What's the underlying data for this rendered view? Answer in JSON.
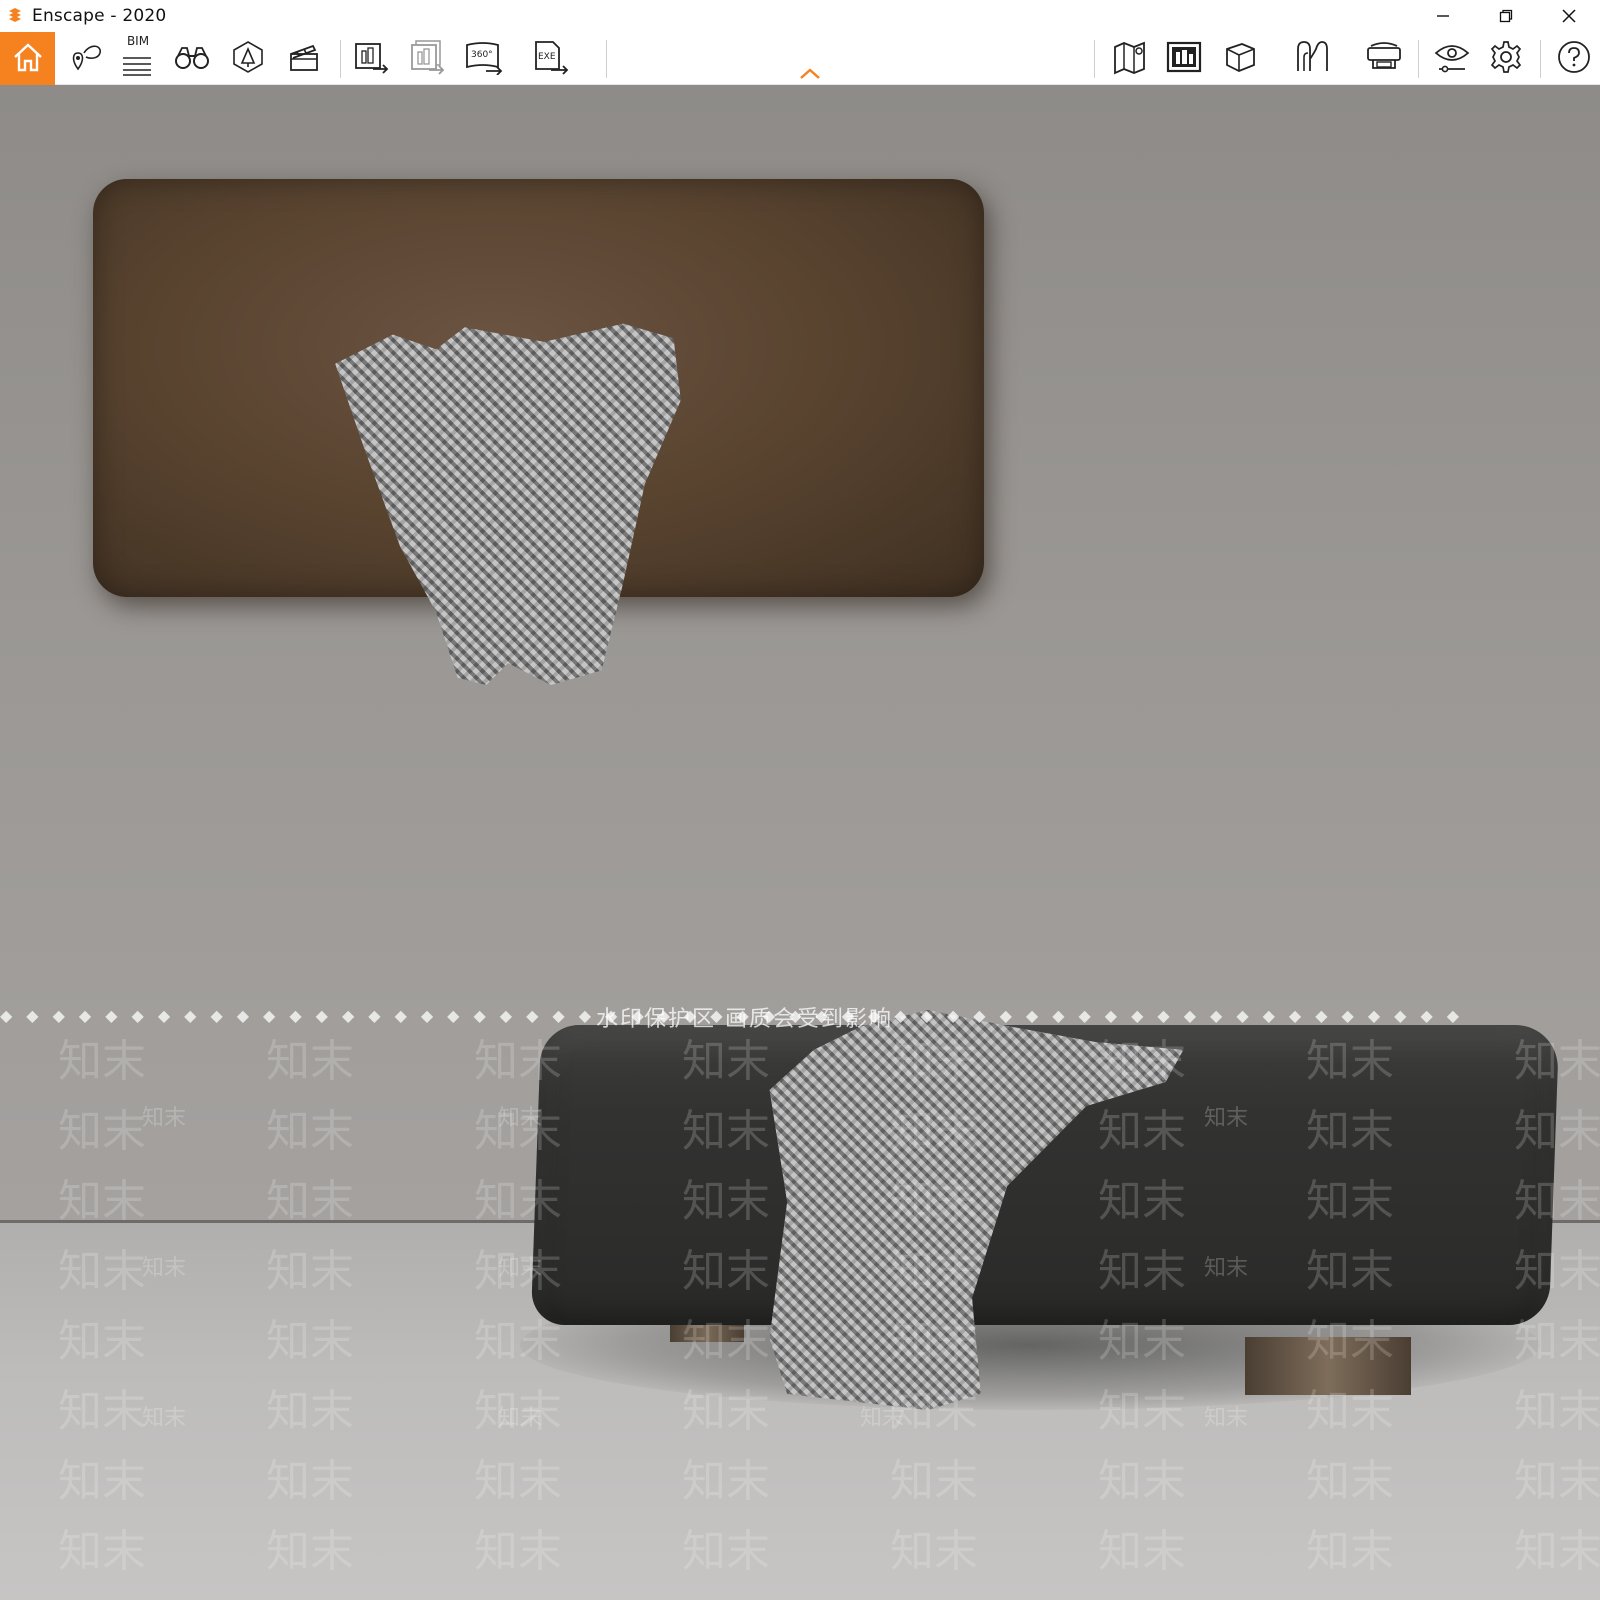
{
  "window": {
    "title": "Enscape - 2020",
    "controls": [
      "minimize",
      "restore",
      "close"
    ]
  },
  "toolbar": {
    "accent_color": "#f5821f",
    "left_icons": [
      {
        "name": "home-icon",
        "active": true
      },
      {
        "name": "views-icon"
      },
      {
        "name": "bim-icon",
        "label": "BIM"
      },
      {
        "name": "binoculars-icon"
      },
      {
        "name": "atmosphere-icon"
      },
      {
        "name": "video-editor-icon"
      }
    ],
    "export_icons": [
      {
        "name": "render-screenshot-icon"
      },
      {
        "name": "batch-render-icon"
      },
      {
        "name": "panorama-360-icon",
        "label": "360°"
      },
      {
        "name": "exe-export-icon",
        "label": "EXE"
      }
    ],
    "right_icons": [
      {
        "name": "map-icon"
      },
      {
        "name": "asset-library-icon"
      },
      {
        "name": "cube-icon"
      },
      {
        "name": "walk-mode-icon"
      },
      {
        "name": "vr-headset-icon"
      },
      {
        "name": "visual-settings-icon"
      },
      {
        "name": "settings-gear-icon"
      },
      {
        "name": "help-icon"
      }
    ]
  },
  "viewport": {
    "watermark_banner": "水印保护区  画质会受到影响",
    "watermark_text": "知末",
    "scene": "Leather headboard with herringbone throw; dark leather ottoman bench with throw"
  }
}
